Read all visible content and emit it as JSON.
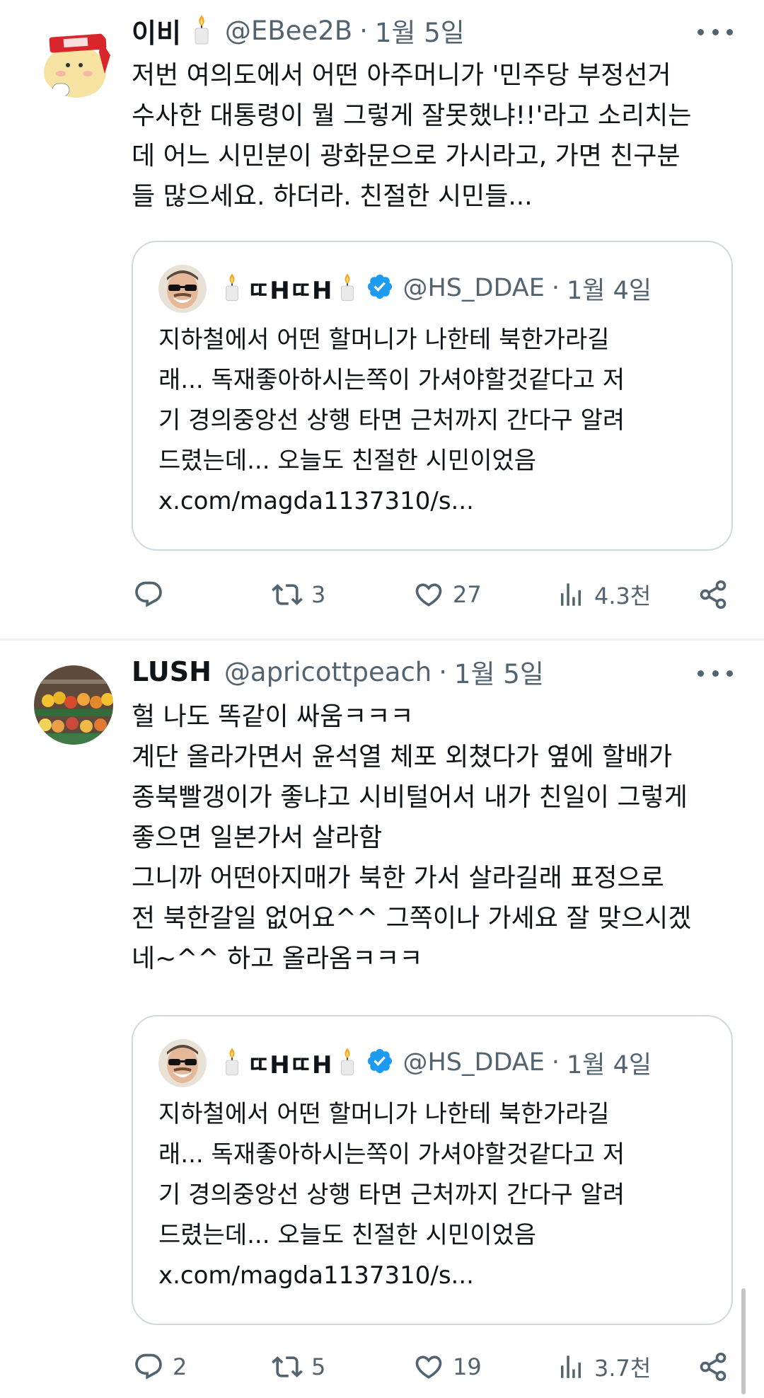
{
  "tweets": [
    {
      "name": "이비",
      "handle": "@EBee2B",
      "dot": "·",
      "time": "1월 5일",
      "text": "저번 여의도에서 어떤 아주머니가 '민주당 부정선거\n수사한 대통령이 뭘 그렇게 잘못했냐!!'라고 소리치는\n데 어느 시민분이 광화문으로 가시라고, 가면 친구분\n들 많으세요. 하더라. 친절한 시민들...",
      "quote": {
        "name": "ㄸHㄸH",
        "handle": "@HS_DDAE",
        "dot": "·",
        "time": "1월 4일",
        "text": "지하철에서 어떤 할머니가 나한테 북한가라길\n래... 독재좋아하시는쪽이 가셔야할것같다고 저\n기 경의중앙선 상행 타면 근처까지 간다구 알려\n드렸는데... 오늘도 친절한 시민이었음\nx.com/magda1137310/s..."
      },
      "actions": {
        "reply": "",
        "retweet": "3",
        "like": "27",
        "views": "4.3천"
      }
    },
    {
      "name": "LUSH",
      "handle": "@apricottpeach",
      "dot": "·",
      "time": "1월 5일",
      "text": "헐 나도 똑같이 싸움ㅋㅋㅋ\n계단 올라가면서 윤석열 체포 외쳤다가 옆에 할배가\n종북빨갱이가 좋냐고 시비털어서 내가 친일이 그렇게\n좋으면 일본가서 살라함\n그니까 어떤아지매가 북한 가서 살라길래 표정으로\n전 북한갈일 없어요^^ 그쪽이나 가세요 잘 맞으시겠\n네~^^ 하고 올라옴ㅋㅋㅋ",
      "quote": {
        "name": "ㄸHㄸH",
        "handle": "@HS_DDAE",
        "dot": "·",
        "time": "1월 4일",
        "text": "지하철에서 어떤 할머니가 나한테 북한가라길\n래... 독재좋아하시는쪽이 가셔야할것같다고 저\n기 경의중앙선 상행 타면 근처까지 간다구 알려\n드렸는데... 오늘도 친절한 시민이었음\nx.com/magda1137310/s..."
      },
      "actions": {
        "reply": "2",
        "retweet": "5",
        "like": "19",
        "views": "3.7천"
      }
    }
  ],
  "icons": {
    "reply": "reply-icon",
    "retweet": "retweet-icon",
    "like": "heart-icon",
    "views": "views-icon",
    "share": "share-icon",
    "verified": "verified-badge-icon",
    "candle": "candle-icon",
    "more": "more-icon"
  },
  "colors": {
    "text": "#0f1419",
    "muted": "#536471",
    "border": "#cfd9de",
    "verified": "#1d9bf0"
  }
}
